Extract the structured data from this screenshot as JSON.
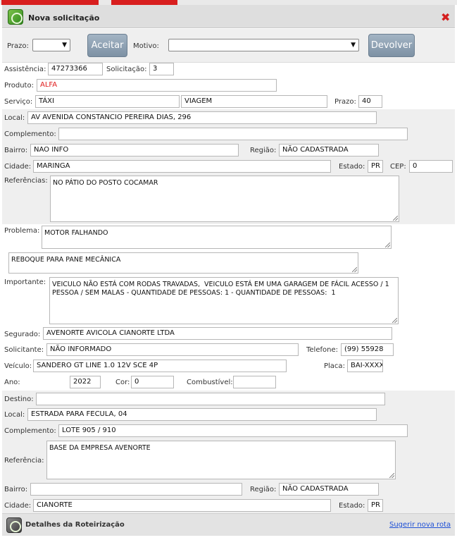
{
  "dialog": {
    "title": "Nova solicitação",
    "close_icon": "close-icon"
  },
  "toolbar": {
    "prazo_label": "Prazo:",
    "prazo_value": "",
    "aceitar_label": "Aceitar",
    "motivo_label": "Motivo:",
    "motivo_value": "",
    "devolver_label": "Devolver"
  },
  "form": {
    "assistencia_label": "Assistência:",
    "assistencia": "47273366",
    "solicitacao_label": "Solicitação:",
    "solicitacao": "3",
    "produto_label": "Produto:",
    "produto": "ALFA",
    "servico_label": "Serviço:",
    "servico": "TÁXI",
    "servico2": "VIAGEM",
    "prazo_label": "Prazo:",
    "prazo": "40",
    "local_label": "Local:",
    "local": "AV AVENIDA CONSTANCIO PEREIRA DIAS, 296",
    "complemento_label": "Complemento:",
    "complemento": "",
    "bairro_label": "Bairro:",
    "bairro": "NAO INFO",
    "regiao_label": "Região:",
    "regiao": "NÃO CADASTRADA",
    "cidade_label": "Cidade:",
    "cidade": "MARINGA",
    "estado_label": "Estado:",
    "estado": "PR",
    "cep_label": "CEP:",
    "cep": "0",
    "referencias_label": "Referências:",
    "referencias": "NO PÁTIO DO POSTO COCAMAR",
    "problema_label": "Problema:",
    "problema": "MOTOR FALHANDO",
    "servico_desc": "REBOQUE PARA PANE MECÂNICA",
    "importante_label": "Importante:",
    "importante": "VEICULO NÃO ESTÁ COM RODAS TRAVADAS,  VEICULO ESTÁ EM UMA GARAGEM DE FÁCIL ACESSO / 1 PESSOA / SEM MALAS - QUANTIDADE DE PESSOAS: 1 - QUANTIDADE DE PESSOAS:  1",
    "segurado_label": "Segurado:",
    "segurado": "AVENORTE AVICOLA CIANORTE LTDA",
    "solicitante_label": "Solicitante:",
    "solicitante": "NÃO INFORMADO",
    "telefone_label": "Telefone:",
    "telefone": "(99) 55928",
    "veiculo_label": "Veículo:",
    "veiculo": "SANDERO GT LINE 1.0 12V SCE 4P",
    "placa_label": "Placa:",
    "placa": "BAI-XXXX",
    "ano_label": "Ano:",
    "ano": "2022",
    "cor_label": "Cor:",
    "cor": "0",
    "combustivel_label": "Combustível:",
    "combustivel": ""
  },
  "destino": {
    "destino_label": "Destino:",
    "destino": "",
    "local_label": "Local:",
    "local": "ESTRADA PARA FECULA, 04",
    "complemento_label": "Complemento:",
    "complemento": "LOTE 905 / 910",
    "referencia_label": "Referência:",
    "referencia": "BASE DA EMPRESA AVENORTE",
    "bairro_label": "Bairro:",
    "bairro": "",
    "regiao_label": "Região:",
    "regiao": "NÃO CADASTRADA",
    "cidade_label": "Cidade:",
    "cidade": "CIANORTE",
    "estado_label": "Estado:",
    "estado": "PR"
  },
  "footer": {
    "title": "Detalhes da Roteirização",
    "link": "Sugerir nova rota"
  }
}
